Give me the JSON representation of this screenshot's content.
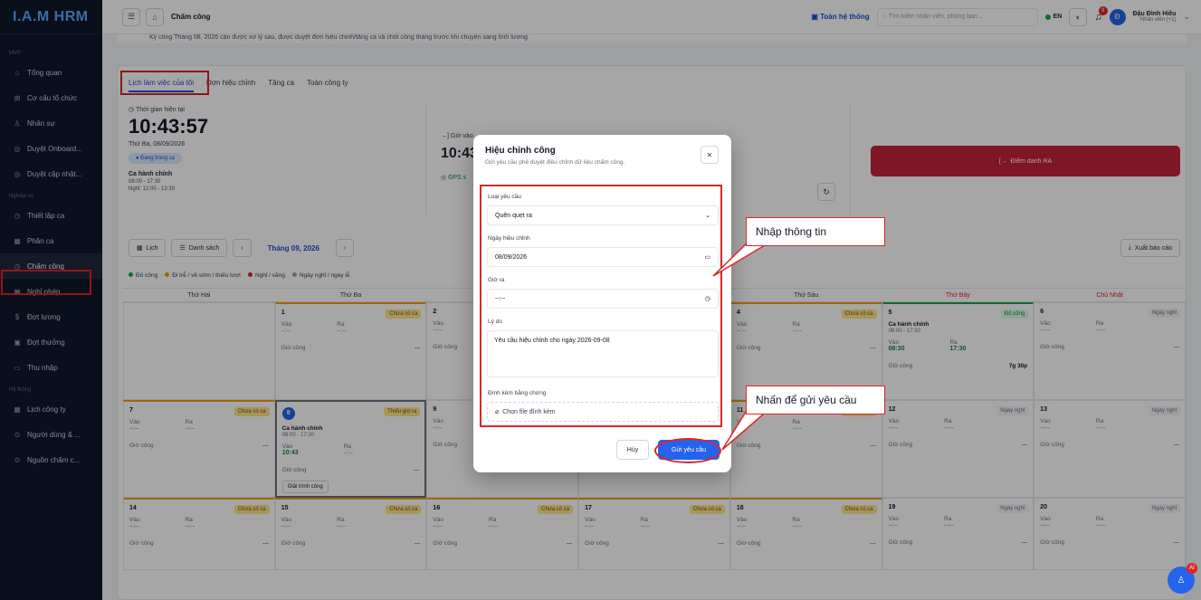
{
  "app": {
    "logo": "I.A.M HRM"
  },
  "sidebar": {
    "sections": [
      "MVP",
      "Nghiệp vụ",
      "Hệ thống"
    ],
    "items": [
      {
        "label": "Tổng quan",
        "icon": "home-icon"
      },
      {
        "label": "Cơ cấu tổ chức",
        "icon": "org-icon"
      },
      {
        "label": "Nhân sự",
        "icon": "users-icon"
      },
      {
        "label": "Duyệt Onboard...",
        "icon": "check-icon"
      },
      {
        "label": "Duyệt cập nhật...",
        "icon": "check-icon"
      },
      {
        "label": "Thiết lập ca",
        "icon": "clock-icon"
      },
      {
        "label": "Phân ca",
        "icon": "calendar-icon"
      },
      {
        "label": "Chấm công",
        "icon": "clock-icon"
      },
      {
        "label": "Nghỉ phép",
        "icon": "calendar-icon"
      },
      {
        "label": "Đợt lương",
        "icon": "dollar-icon"
      },
      {
        "label": "Đợt thưởng",
        "icon": "gift-icon"
      },
      {
        "label": "Thu nhập",
        "icon": "wallet-icon"
      },
      {
        "label": "Lịch công ty",
        "icon": "calendar-icon"
      },
      {
        "label": "Người dùng & ...",
        "icon": "user-icon"
      },
      {
        "label": "Nguồn chấm c...",
        "icon": "source-icon"
      }
    ]
  },
  "topbar": {
    "breadcrumb": "Chấm công",
    "org": "Toàn hệ thống",
    "search_placeholder": "Tìm kiếm nhân viên, phòng ban...",
    "lang": "EN",
    "bell_count": "9",
    "user_name": "Đậu Đình Hiếu",
    "user_role": "Nhân viên (+1)",
    "avatar": "Đ"
  },
  "notice": "Kỳ công Tháng 08, 2026 cần được xử lý sau, được duyệt đơn hiệu chỉnh/tăng ca và chốt công tháng trước khi chuyển sang tính lương.",
  "tabs": [
    "Lịch làm việc của tôi",
    "Đơn hiệu chỉnh",
    "Tăng ca",
    "Toàn công ty"
  ],
  "clock": {
    "label": "Thời gian hiện tại",
    "time": "10:43:57",
    "date": "Thứ Ba, 08/09/2026",
    "status": "Đang trong ca",
    "shift": "Ca hành chính",
    "hours": "08:00 - 17:30",
    "break": "Nghỉ: 12:00 - 13:30",
    "checkin_label": "Giờ vào",
    "checkin": "10:43",
    "gps": "GPS s"
  },
  "checkout_button": "Điểm danh RA",
  "toolbar": {
    "calendar": "Lịch",
    "list": "Danh sách",
    "month": "Tháng 09, 2026",
    "export": "Xuất báo cáo"
  },
  "legend": [
    {
      "label": "Đủ công",
      "color": "#16a34a"
    },
    {
      "label": "Đi trễ / về sớm / thiếu lượt",
      "color": "#f59e0b"
    },
    {
      "label": "Nghỉ / vắng",
      "color": "#dc2626"
    },
    {
      "label": "Ngày nghỉ / ngày lễ",
      "color": "#9ca3af"
    }
  ],
  "weekdays": [
    "Thứ Hai",
    "Thứ Ba",
    "Thứ Tư",
    "Thứ Năm",
    "Thứ Sáu",
    "Thứ Bảy",
    "Chủ Nhật"
  ],
  "calendar": {
    "in_label": "Vào",
    "out_label": "Ra",
    "hours_label": "Giờ công",
    "dash": "--:--",
    "rows": [
      [
        {
          "day": "",
          "status": ""
        },
        {
          "day": "1",
          "status": "Chưa có ca",
          "kind": "o"
        },
        {
          "day": "2",
          "status": "",
          "kind": ""
        },
        {
          "day": "",
          "status": ""
        },
        {
          "day": "4",
          "status": "Chưa có ca",
          "kind": "o"
        },
        {
          "day": "5",
          "status": "Đủ công",
          "kind": "g",
          "shift": "Ca hành chính",
          "hours": "08:00 - 17:30",
          "in": "08:30",
          "out": "17:30",
          "total": "7g 30p"
        },
        {
          "day": "6",
          "status": "Ngày nghỉ",
          "kind": "n"
        }
      ],
      [
        {
          "day": "7",
          "status": "Chưa có ca",
          "kind": "o"
        },
        {
          "day": "8",
          "status": "Thiếu giờ ra",
          "kind": "o",
          "shift": "Ca hành chính",
          "hours": "08:00 - 17:30",
          "in": "10:43",
          "explain": "Giải trình công"
        },
        {
          "day": "9",
          "status": "",
          "kind": ""
        },
        {
          "day": "",
          "status": ""
        },
        {
          "day": "11",
          "status": "Chưa có ca",
          "kind": "o"
        },
        {
          "day": "12",
          "status": "Ngày nghỉ",
          "kind": "n"
        },
        {
          "day": "13",
          "status": "Ngày nghỉ",
          "kind": "n"
        }
      ],
      [
        {
          "day": "14",
          "status": "Chưa có ca",
          "kind": "o"
        },
        {
          "day": "15",
          "status": "Chưa có ca",
          "kind": "o"
        },
        {
          "day": "16",
          "status": "Chưa có ca",
          "kind": "o"
        },
        {
          "day": "17",
          "status": "Chưa có ca",
          "kind": "o"
        },
        {
          "day": "18",
          "status": "Chưa có ca",
          "kind": "o"
        },
        {
          "day": "19",
          "status": "Ngày nghỉ",
          "kind": "n"
        },
        {
          "day": "20",
          "status": "Ngày nghỉ",
          "kind": "n"
        }
      ]
    ]
  },
  "modal": {
    "title": "Hiệu chỉnh công",
    "subtitle": "Gửi yêu cầu phê duyệt điều chỉnh dữ liệu chấm công.",
    "type_label": "Loại yêu cầu",
    "type_value": "Quên quẹt ra",
    "date_label": "Ngày hiệu chỉnh",
    "date_value": "08/09/2026",
    "time_label": "Giờ ra",
    "time_value": "--:--",
    "reason_label": "Lý do",
    "reason_value": "Yêu cầu hiệu chỉnh cho ngày 2026-09-08",
    "attach_label": "Đính kèm bằng chứng",
    "attach_button": "Chọn file đính kèm",
    "cancel": "Hủy",
    "submit": "Gửi yêu cầu"
  },
  "callouts": {
    "input": "Nhập thông tin",
    "submit": "Nhấn để gửi yêu cầu"
  },
  "fab": {
    "badge": "AI"
  }
}
